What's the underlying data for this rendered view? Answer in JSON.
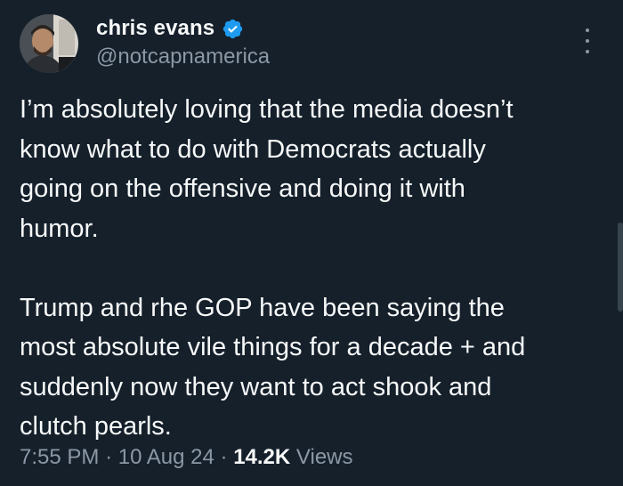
{
  "author": {
    "display_name": "chris evans",
    "handle": "@notcapnamerica",
    "verified": true,
    "avatar": "profile-photo"
  },
  "icons": {
    "verified": "verified-badge-icon",
    "more": "more-options-icon"
  },
  "tweet": {
    "paragraphs": [
      "I’m absolutely loving that the media doesn’t\nknow what to do with Democrats actually\ngoing on the offensive and doing it with\nhumor.",
      "Trump and rhe GOP have been saying the\nmost absolute vile things for a decade + and\nsuddenly now they want to act shook and\nclutch pearls."
    ]
  },
  "meta": {
    "time": "7:55 PM",
    "separator": "·",
    "date": "10 Aug 24",
    "views_count": "14.2K",
    "views_label": "Views"
  },
  "colors": {
    "background": "#15202b",
    "text_primary": "#f7f9f9",
    "text_secondary": "#8b98a5",
    "verified_blue": "#1d9bf0"
  }
}
